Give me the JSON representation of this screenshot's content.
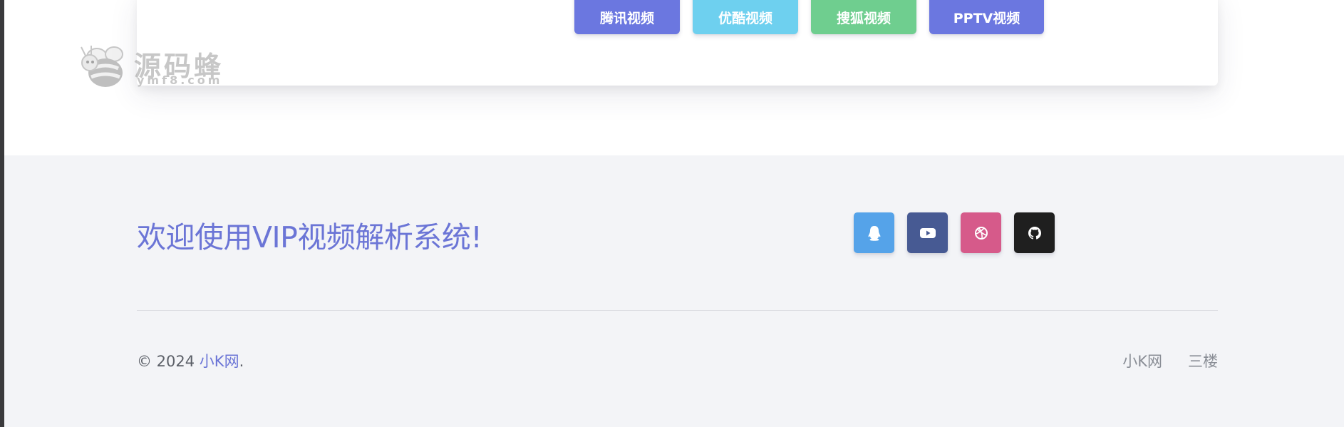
{
  "buttons": {
    "tencent": "腾讯视频",
    "youku": "优酷视频",
    "sohu": "搜狐视频",
    "pptv": "PPTV视频"
  },
  "watermark": {
    "cn": "源码蜂",
    "en": "ymf8.com"
  },
  "footer": {
    "welcome": "欢迎使用VIP视频解析系统!",
    "copyright_prefix": "© 2024 ",
    "copyright_link": "小K网",
    "copyright_suffix": ".",
    "links": [
      "小K网",
      "三楼"
    ]
  },
  "social_icons": [
    "qq-icon",
    "youtube-icon",
    "dribbble-icon",
    "github-icon"
  ],
  "colors": {
    "accent": "#6b77e0",
    "youku": "#6ed0ef",
    "sohu": "#6fce8f",
    "qq": "#55a3e9",
    "youtube": "#475a93",
    "dribbble": "#d65a8a",
    "github": "#1f1f1f",
    "footer_bg": "#f3f4f7"
  }
}
